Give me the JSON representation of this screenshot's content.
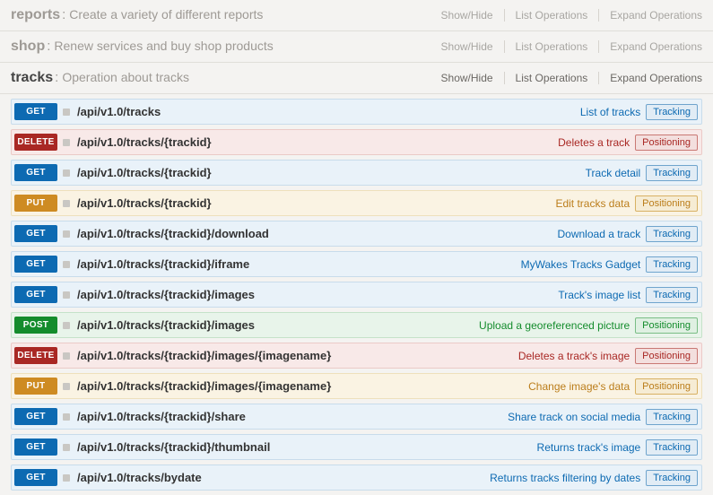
{
  "sections": [
    {
      "id": "reports",
      "title": "reports",
      "desc": "Create a variety of different reports",
      "muted": true,
      "opsDark": false
    },
    {
      "id": "shop",
      "title": "shop",
      "desc": "Renew services and buy shop products",
      "muted": true,
      "opsDark": false
    },
    {
      "id": "tracks",
      "title": "tracks",
      "desc": "Operation about tracks",
      "muted": false,
      "opsDark": true
    }
  ],
  "ops": {
    "showhide": "Show/Hide",
    "list": "List Operations",
    "expand": "Expand Operations"
  },
  "endpoints": [
    {
      "method": "GET",
      "path": "/api/v1.0/tracks",
      "summary": "List of tracks",
      "tag": "Tracking"
    },
    {
      "method": "DELETE",
      "path": "/api/v1.0/tracks/{trackid}",
      "summary": "Deletes a track",
      "tag": "Positioning"
    },
    {
      "method": "GET",
      "path": "/api/v1.0/tracks/{trackid}",
      "summary": "Track detail",
      "tag": "Tracking"
    },
    {
      "method": "PUT",
      "path": "/api/v1.0/tracks/{trackid}",
      "summary": "Edit tracks data",
      "tag": "Positioning"
    },
    {
      "method": "GET",
      "path": "/api/v1.0/tracks/{trackid}/download",
      "summary": "Download a track",
      "tag": "Tracking"
    },
    {
      "method": "GET",
      "path": "/api/v1.0/tracks/{trackid}/iframe",
      "summary": "MyWakes Tracks Gadget",
      "tag": "Tracking"
    },
    {
      "method": "GET",
      "path": "/api/v1.0/tracks/{trackid}/images",
      "summary": "Track's image list",
      "tag": "Tracking"
    },
    {
      "method": "POST",
      "path": "/api/v1.0/tracks/{trackid}/images",
      "summary": "Upload a georeferenced picture",
      "tag": "Positioning"
    },
    {
      "method": "DELETE",
      "path": "/api/v1.0/tracks/{trackid}/images/{imagename}",
      "summary": "Deletes a track's image",
      "tag": "Positioning"
    },
    {
      "method": "PUT",
      "path": "/api/v1.0/tracks/{trackid}/images/{imagename}",
      "summary": "Change image's data",
      "tag": "Positioning"
    },
    {
      "method": "GET",
      "path": "/api/v1.0/tracks/{trackid}/share",
      "summary": "Share track on social media",
      "tag": "Tracking"
    },
    {
      "method": "GET",
      "path": "/api/v1.0/tracks/{trackid}/thumbnail",
      "summary": "Returns track's image",
      "tag": "Tracking"
    },
    {
      "method": "GET",
      "path": "/api/v1.0/tracks/bydate",
      "summary": "Returns tracks filtering by dates",
      "tag": "Tracking"
    }
  ]
}
